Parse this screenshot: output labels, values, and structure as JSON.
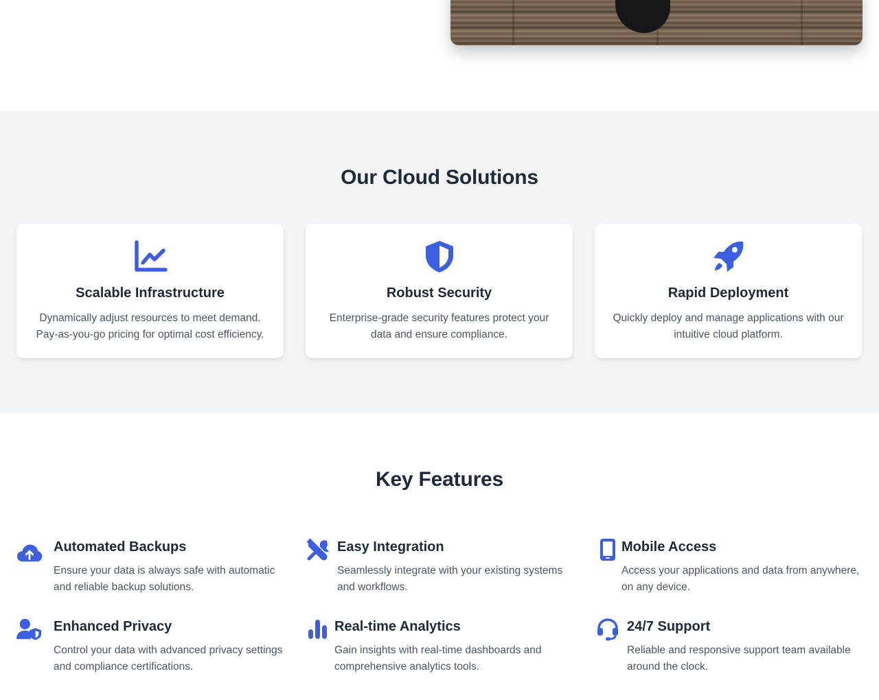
{
  "colors": {
    "accent": "#3b5fe0",
    "section_bg": "#f3f4f6",
    "heading": "#1f2937",
    "body_text": "#4b5563"
  },
  "solutions": {
    "title": "Our Cloud Solutions",
    "cards": [
      {
        "icon": "chart-line-icon",
        "title": "Scalable Infrastructure",
        "text": "Dynamically adjust resources to meet demand. Pay-as-you-go pricing for optimal cost efficiency."
      },
      {
        "icon": "shield-icon",
        "title": "Robust Security",
        "text": "Enterprise-grade security features protect your data and ensure compliance."
      },
      {
        "icon": "rocket-icon",
        "title": "Rapid Deployment",
        "text": "Quickly deploy and manage applications with our intuitive cloud platform."
      }
    ]
  },
  "features": {
    "title": "Key Features",
    "items": [
      {
        "icon": "cloud-upload-icon",
        "title": "Automated Backups",
        "text": "Ensure your data is always safe with automatic and reliable backup solutions."
      },
      {
        "icon": "tools-icon",
        "title": "Easy Integration",
        "text": "Seamlessly integrate with your existing systems and workflows."
      },
      {
        "icon": "mobile-icon",
        "title": "Mobile Access",
        "text": "Access your applications and data from anywhere, on any device."
      },
      {
        "icon": "user-shield-icon",
        "title": "Enhanced Privacy",
        "text": "Control your data with advanced privacy settings and compliance certifications."
      },
      {
        "icon": "bar-chart-icon",
        "title": "Real-time Analytics",
        "text": "Gain insights with real-time dashboards and comprehensive analytics tools."
      },
      {
        "icon": "headset-icon",
        "title": "24/7 Support",
        "text": "Reliable and responsive support team available around the clock."
      }
    ]
  }
}
